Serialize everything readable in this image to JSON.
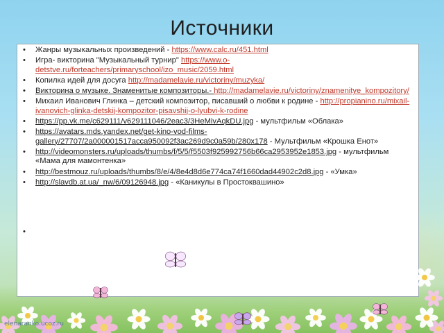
{
  "slide": {
    "title": "Источники",
    "watermark": "elenaranko.ucoz.ru",
    "bullet_char": "•",
    "items": [
      {
        "prefix": "Жанры музыкальных произведений - ",
        "link": "https://www.calc.ru/451.html",
        "suffix": ""
      },
      {
        "prefix": " Игра- викторина \"Музыкальный турнир\" ",
        "link": "https://www.o-detstve.ru/forteachers/primaryschool/izo_music/2059.html",
        "suffix": ""
      },
      {
        "prefix": " Копилка идей для досуга ",
        "link": "http://madamelavie.ru/victoriny/muzyka/",
        "suffix": ""
      },
      {
        "prefix_underlined": "Викторина о музыке. Знаменитые композиторы.- ",
        "link": "http://madamelavie.ru/victoriny/znamenitye_kompozitory/ ",
        "suffix": ""
      },
      {
        "prefix": "Михаил Иванович Глинка – детский композитор, писавший о любви к родине - ",
        "link": "http://propianino.ru/mixail-ivanovich-glinka-detskij-kompozitor-pisavshij-o-lyubvi-k-rodine",
        "suffix": ""
      },
      {
        "link_dark": "https://pp.vk.me/c629111/v629111046/2eac3/3HeMivAqkDU.jpg",
        "suffix": " - мультфильм «Облака»"
      },
      {
        "link_dark": "https://avatars.mds.yandex.net/get-kino-vod-films-gallery/27707/2a000001517acca950092f3ac269d9c0a59b/280x178",
        "suffix": "  - Мультфильм «Крошка Енот»"
      },
      {
        "link_dark": "http://videomonsters.ru/uploads/thumbs/f/5/5/f5503f925992756b66ca2953952e1853.jpg",
        "suffix": " - мультфильм «Мама для мамонтенка»"
      },
      {
        "link_dark": "http://bestmouz.ru/uploads/thumbs/8/e/4/8e4d8d6e774ca74f1660dad44902c2d8.jpg",
        "suffix": " - «Умка»"
      },
      {
        "link_dark": "http://slavdb.at.ua/_nw/6/09126948.jpg",
        "suffix": " - «Каникулы в Простоквашино»"
      }
    ]
  },
  "colors": {
    "link": "#c0392b",
    "text": "#222222",
    "panel": "#ffffff",
    "sky": "#a9dff2",
    "grass": "#86c260"
  },
  "icons": [
    "flower-icon",
    "butterfly-icon"
  ]
}
